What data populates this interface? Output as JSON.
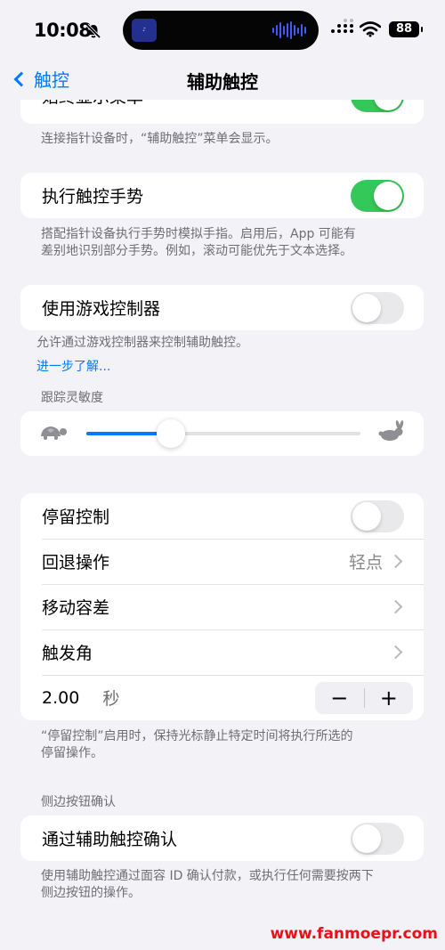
{
  "status": {
    "time": "10:08",
    "battery": "88"
  },
  "nav": {
    "back_label": "触控",
    "title": "辅助触控"
  },
  "group0": {
    "label": "始终显示菜单",
    "toggle_on": true,
    "footer": "连接指针设备时，“辅助触控”菜单会显示。"
  },
  "group1": {
    "label": "执行触控手势",
    "toggle_on": true,
    "footer_line1": "搭配指针设备执行手势时模拟手指。启用后，App 可能有",
    "footer_line2": "差别地识别部分手势。例如，滚动可能优先于文本选择。"
  },
  "group2": {
    "label": "使用游戏控制器",
    "toggle_on": false,
    "footer": "允许通过游戏控制器来控制辅助触控。",
    "link": "进一步了解..."
  },
  "tracking": {
    "header": "跟踪灵敏度",
    "value": 0.31,
    "min_icon": "turtle-icon",
    "max_icon": "rabbit-icon"
  },
  "dwell": {
    "rows": {
      "dwell_control": {
        "label": "停留控制",
        "toggle_on": false
      },
      "fallback": {
        "label": "回退操作",
        "value": "轻点"
      },
      "tolerance": {
        "label": "移动容差"
      },
      "hot_corners": {
        "label": "触发角"
      },
      "duration": {
        "value": "2.00",
        "unit": "秒",
        "minus": "−",
        "plus": "+"
      }
    },
    "footer_line1": "“停留控制”启用时，保持光标静止特定时间将执行所选的",
    "footer_line2": "停留操作。"
  },
  "side_button": {
    "header": "侧边按钮确认",
    "label": "通过辅助触控确认",
    "toggle_on": false,
    "footer_line1": "使用辅助触控通过面容 ID 确认付款，或执行任何需要按两下",
    "footer_line2": "侧边按钮的操作。"
  },
  "watermark": "www.fanmoepr.com",
  "colors": {
    "accent": "#007aff",
    "toggle_on": "#34c759",
    "toggle_off": "#e9e9eb",
    "watermark": "#e8101a"
  }
}
